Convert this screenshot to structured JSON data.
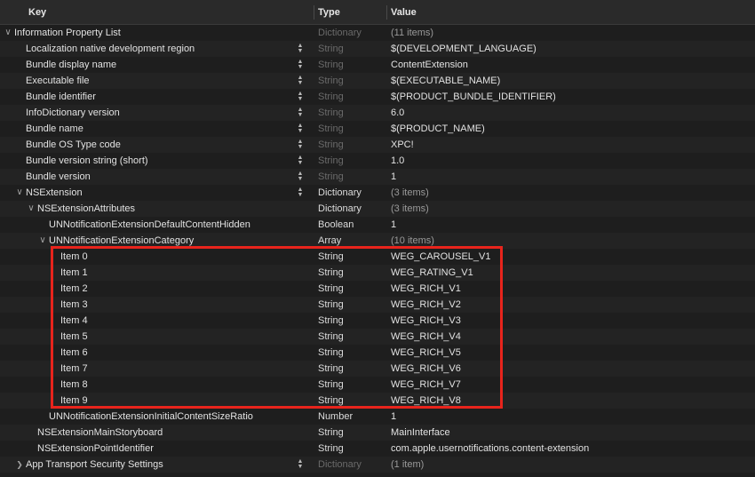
{
  "header": {
    "key": "Key",
    "type": "Type",
    "value": "Value"
  },
  "rows": [
    {
      "indent": 0,
      "disclosure": "open",
      "stepper": false,
      "key": "Information Property List",
      "type": "Dictionary",
      "type_dim": true,
      "value": "(11 items)",
      "value_dim": true
    },
    {
      "indent": 1,
      "disclosure": "none",
      "stepper": true,
      "key": "Localization native development region",
      "type": "String",
      "type_dim": true,
      "value": "$(DEVELOPMENT_LANGUAGE)",
      "value_dim": false
    },
    {
      "indent": 1,
      "disclosure": "none",
      "stepper": true,
      "key": "Bundle display name",
      "type": "String",
      "type_dim": true,
      "value": "ContentExtension",
      "value_dim": false
    },
    {
      "indent": 1,
      "disclosure": "none",
      "stepper": true,
      "key": "Executable file",
      "type": "String",
      "type_dim": true,
      "value": "$(EXECUTABLE_NAME)",
      "value_dim": false
    },
    {
      "indent": 1,
      "disclosure": "none",
      "stepper": true,
      "key": "Bundle identifier",
      "type": "String",
      "type_dim": true,
      "value": "$(PRODUCT_BUNDLE_IDENTIFIER)",
      "value_dim": false
    },
    {
      "indent": 1,
      "disclosure": "none",
      "stepper": true,
      "key": "InfoDictionary version",
      "type": "String",
      "type_dim": true,
      "value": "6.0",
      "value_dim": false
    },
    {
      "indent": 1,
      "disclosure": "none",
      "stepper": true,
      "key": "Bundle name",
      "type": "String",
      "type_dim": true,
      "value": "$(PRODUCT_NAME)",
      "value_dim": false
    },
    {
      "indent": 1,
      "disclosure": "none",
      "stepper": true,
      "key": "Bundle OS Type code",
      "type": "String",
      "type_dim": true,
      "value": "XPC!",
      "value_dim": false
    },
    {
      "indent": 1,
      "disclosure": "none",
      "stepper": true,
      "key": "Bundle version string (short)",
      "type": "String",
      "type_dim": true,
      "value": "1.0",
      "value_dim": false
    },
    {
      "indent": 1,
      "disclosure": "none",
      "stepper": true,
      "key": "Bundle version",
      "type": "String",
      "type_dim": true,
      "value": "1",
      "value_dim": false
    },
    {
      "indent": 1,
      "disclosure": "open",
      "stepper": true,
      "key": "NSExtension",
      "type": "Dictionary",
      "type_dim": false,
      "value": "(3 items)",
      "value_dim": true
    },
    {
      "indent": 2,
      "disclosure": "open",
      "stepper": false,
      "key": "NSExtensionAttributes",
      "type": "Dictionary",
      "type_dim": false,
      "value": "(3 items)",
      "value_dim": true
    },
    {
      "indent": 3,
      "disclosure": "none",
      "stepper": false,
      "key": "UNNotificationExtensionDefaultContentHidden",
      "type": "Boolean",
      "type_dim": false,
      "value": "1",
      "value_dim": false
    },
    {
      "indent": 3,
      "disclosure": "open",
      "stepper": false,
      "key": "UNNotificationExtensionCategory",
      "type": "Array",
      "type_dim": false,
      "value": "(10 items)",
      "value_dim": true
    },
    {
      "indent": 4,
      "disclosure": "none",
      "stepper": false,
      "key": "Item 0",
      "type": "String",
      "type_dim": false,
      "value": "WEG_CAROUSEL_V1",
      "value_dim": false
    },
    {
      "indent": 4,
      "disclosure": "none",
      "stepper": false,
      "key": "Item 1",
      "type": "String",
      "type_dim": false,
      "value": "WEG_RATING_V1",
      "value_dim": false
    },
    {
      "indent": 4,
      "disclosure": "none",
      "stepper": false,
      "key": "Item 2",
      "type": "String",
      "type_dim": false,
      "value": "WEG_RICH_V1",
      "value_dim": false
    },
    {
      "indent": 4,
      "disclosure": "none",
      "stepper": false,
      "key": "Item 3",
      "type": "String",
      "type_dim": false,
      "value": "WEG_RICH_V2",
      "value_dim": false
    },
    {
      "indent": 4,
      "disclosure": "none",
      "stepper": false,
      "key": "Item 4",
      "type": "String",
      "type_dim": false,
      "value": "WEG_RICH_V3",
      "value_dim": false
    },
    {
      "indent": 4,
      "disclosure": "none",
      "stepper": false,
      "key": "Item 5",
      "type": "String",
      "type_dim": false,
      "value": "WEG_RICH_V4",
      "value_dim": false
    },
    {
      "indent": 4,
      "disclosure": "none",
      "stepper": false,
      "key": "Item 6",
      "type": "String",
      "type_dim": false,
      "value": "WEG_RICH_V5",
      "value_dim": false
    },
    {
      "indent": 4,
      "disclosure": "none",
      "stepper": false,
      "key": "Item 7",
      "type": "String",
      "type_dim": false,
      "value": "WEG_RICH_V6",
      "value_dim": false
    },
    {
      "indent": 4,
      "disclosure": "none",
      "stepper": false,
      "key": "Item 8",
      "type": "String",
      "type_dim": false,
      "value": "WEG_RICH_V7",
      "value_dim": false
    },
    {
      "indent": 4,
      "disclosure": "none",
      "stepper": false,
      "key": "Item 9",
      "type": "String",
      "type_dim": false,
      "value": "WEG_RICH_V8",
      "value_dim": false
    },
    {
      "indent": 3,
      "disclosure": "none",
      "stepper": false,
      "key": "UNNotificationExtensionInitialContentSizeRatio",
      "type": "Number",
      "type_dim": false,
      "value": "1",
      "value_dim": false
    },
    {
      "indent": 2,
      "disclosure": "none",
      "stepper": false,
      "key": "NSExtensionMainStoryboard",
      "type": "String",
      "type_dim": false,
      "value": "MainInterface",
      "value_dim": false
    },
    {
      "indent": 2,
      "disclosure": "none",
      "stepper": false,
      "key": "NSExtensionPointIdentifier",
      "type": "String",
      "type_dim": false,
      "value": "com.apple.usernotifications.content-extension",
      "value_dim": false
    },
    {
      "indent": 1,
      "disclosure": "closed",
      "stepper": true,
      "key": "App Transport Security Settings",
      "type": "Dictionary",
      "type_dim": true,
      "value": "(1 item)",
      "value_dim": true
    }
  ],
  "colors": {
    "highlight": "#e8241c",
    "background": "#1e1e1e"
  }
}
